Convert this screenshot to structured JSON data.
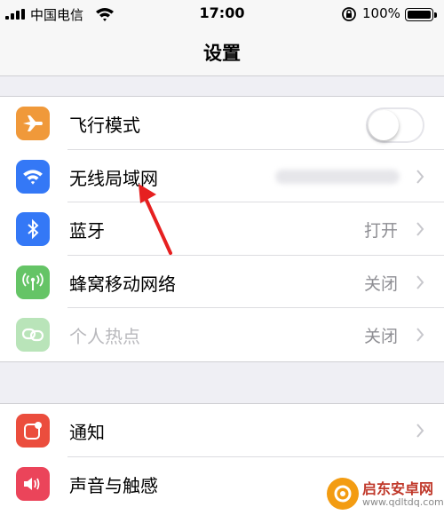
{
  "status_bar": {
    "carrier": "中国电信",
    "time": "17:00",
    "battery": "100%"
  },
  "nav": {
    "title": "设置"
  },
  "group1": [
    {
      "name": "airplane",
      "label": "飞行模式",
      "icon": "airplane-icon",
      "color": "#f0993a",
      "toggle": false
    },
    {
      "name": "wlan",
      "label": "无线局域网",
      "icon": "wifi-icon",
      "color": "#3478f6",
      "value": ""
    },
    {
      "name": "bluetooth",
      "label": "蓝牙",
      "icon": "bluetooth-icon",
      "color": "#3478f6",
      "value": "打开"
    },
    {
      "name": "cellular",
      "label": "蜂窝移动网络",
      "icon": "antenna-icon",
      "color": "#65c466",
      "value": "关闭"
    },
    {
      "name": "hotspot",
      "label": "个人热点",
      "icon": "link-icon",
      "color": "#65c466",
      "value": "关闭",
      "disabled": true
    }
  ],
  "group2": [
    {
      "name": "notifications",
      "label": "通知",
      "icon": "notification-icon",
      "color": "#eb4d3d"
    },
    {
      "name": "sounds",
      "label": "声音与触感",
      "icon": "speaker-icon",
      "color": "#eb445a"
    }
  ],
  "watermark": {
    "name": "启东安卓网",
    "url": "www.qdltdq.com"
  }
}
